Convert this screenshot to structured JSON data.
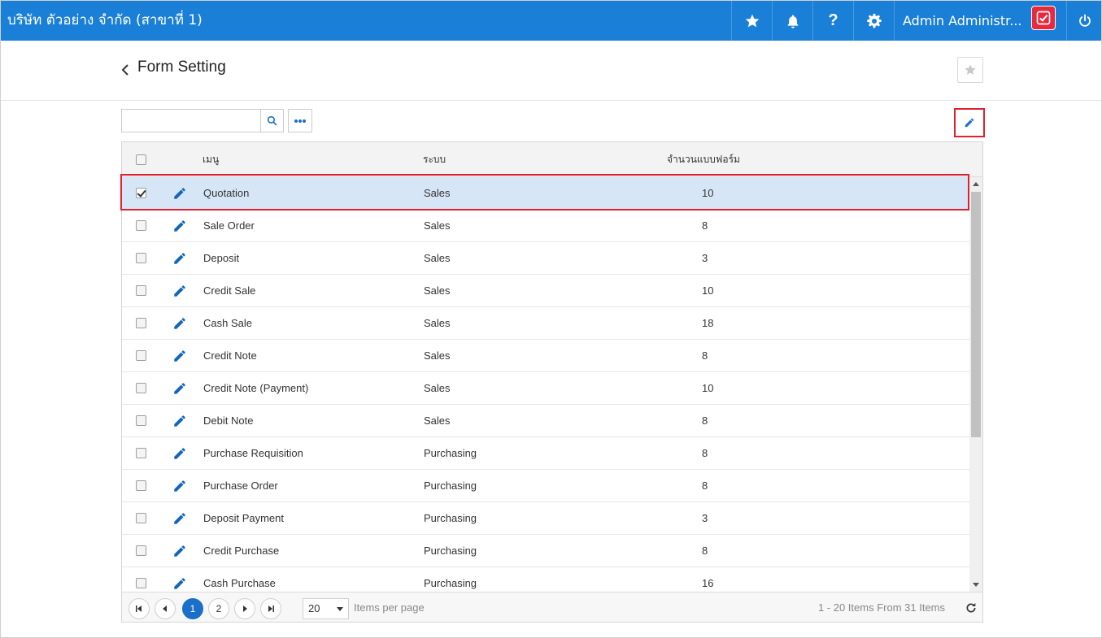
{
  "topbar": {
    "company": "บริษัท ตัวอย่าง จำกัด (สาขาที่ 1)",
    "user_name": "Admin Administr...",
    "help_symbol": "?",
    "bg_color": "#1a7fd6",
    "icons": [
      "star-icon",
      "bell-icon",
      "help-icon",
      "gear-icon",
      "avatar-check-icon",
      "power-icon"
    ]
  },
  "header": {
    "title": "Form Setting"
  },
  "toolbar": {
    "search_value": "",
    "search_placeholder": ""
  },
  "grid": {
    "columns": {
      "menu": "เมนู",
      "system": "ระบบ",
      "count": "จำนวนแบบฟอร์ม"
    },
    "rows": [
      {
        "menu": "Quotation",
        "system": "Sales",
        "count": "10",
        "checked": true
      },
      {
        "menu": "Sale Order",
        "system": "Sales",
        "count": "8",
        "checked": false
      },
      {
        "menu": "Deposit",
        "system": "Sales",
        "count": "3",
        "checked": false
      },
      {
        "menu": "Credit Sale",
        "system": "Sales",
        "count": "10",
        "checked": false
      },
      {
        "menu": "Cash Sale",
        "system": "Sales",
        "count": "18",
        "checked": false
      },
      {
        "menu": "Credit Note",
        "system": "Sales",
        "count": "8",
        "checked": false
      },
      {
        "menu": "Credit Note (Payment)",
        "system": "Sales",
        "count": "10",
        "checked": false
      },
      {
        "menu": "Debit Note",
        "system": "Sales",
        "count": "8",
        "checked": false
      },
      {
        "menu": "Purchase Requisition",
        "system": "Purchasing",
        "count": "8",
        "checked": false
      },
      {
        "menu": "Purchase Order",
        "system": "Purchasing",
        "count": "8",
        "checked": false
      },
      {
        "menu": "Deposit Payment",
        "system": "Purchasing",
        "count": "3",
        "checked": false
      },
      {
        "menu": "Credit Purchase",
        "system": "Purchasing",
        "count": "8",
        "checked": false
      },
      {
        "menu": "Cash Purchase",
        "system": "Purchasing",
        "count": "16",
        "checked": false
      }
    ]
  },
  "pager": {
    "pages": [
      "1",
      "2"
    ],
    "current_page": "1",
    "page_size": "20",
    "items_per_page_label": "Items per page",
    "info": "1 - 20 Items From 31 Items"
  },
  "colors": {
    "accent": "#1a6fc9",
    "highlight_border": "#e0202e",
    "selected_row": "#d7e6f7"
  }
}
